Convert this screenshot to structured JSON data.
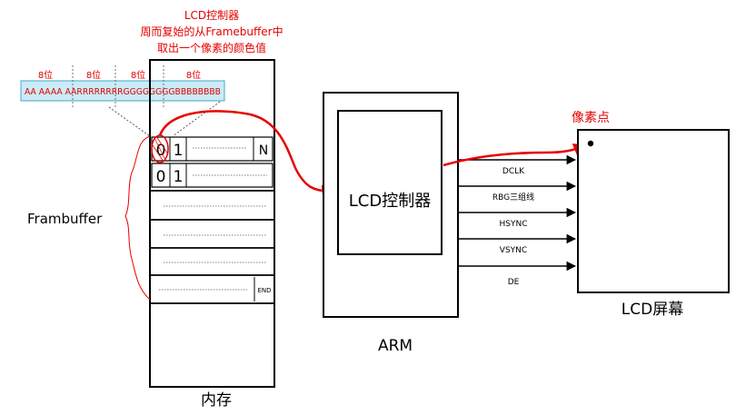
{
  "annotation": {
    "line1": "LCD控制器",
    "line2": "周而复始的从Framebuffer中",
    "line3": "取出一个像素的颜色值"
  },
  "bit_widths": [
    "8位",
    "8位",
    "8位",
    "8位"
  ],
  "pixel_format": "AA AAAA AARRRRRRRRGGGGGGGGBBBBBBBB",
  "memory": {
    "row1": {
      "cell0": "0",
      "cell1": "1",
      "last": "N"
    },
    "row2": {
      "cell0": "0",
      "cell1": "1"
    },
    "end_marker": "END",
    "label": "内存"
  },
  "framebuffer_label": "Frambuffer",
  "arm": {
    "label": "ARM",
    "controller_label": "LCD控制器"
  },
  "signals": [
    "DCLK",
    "RBG三组线",
    "HSYNC",
    "VSYNC",
    "DE"
  ],
  "screen": {
    "label": "LCD屏幕",
    "pixel_label": "像素点"
  },
  "colors": {
    "accent_red": "#e60000",
    "pixel_bar_fill": "#c9ecf7",
    "pixel_bar_stroke": "#4aa6c8",
    "line": "#000000"
  }
}
